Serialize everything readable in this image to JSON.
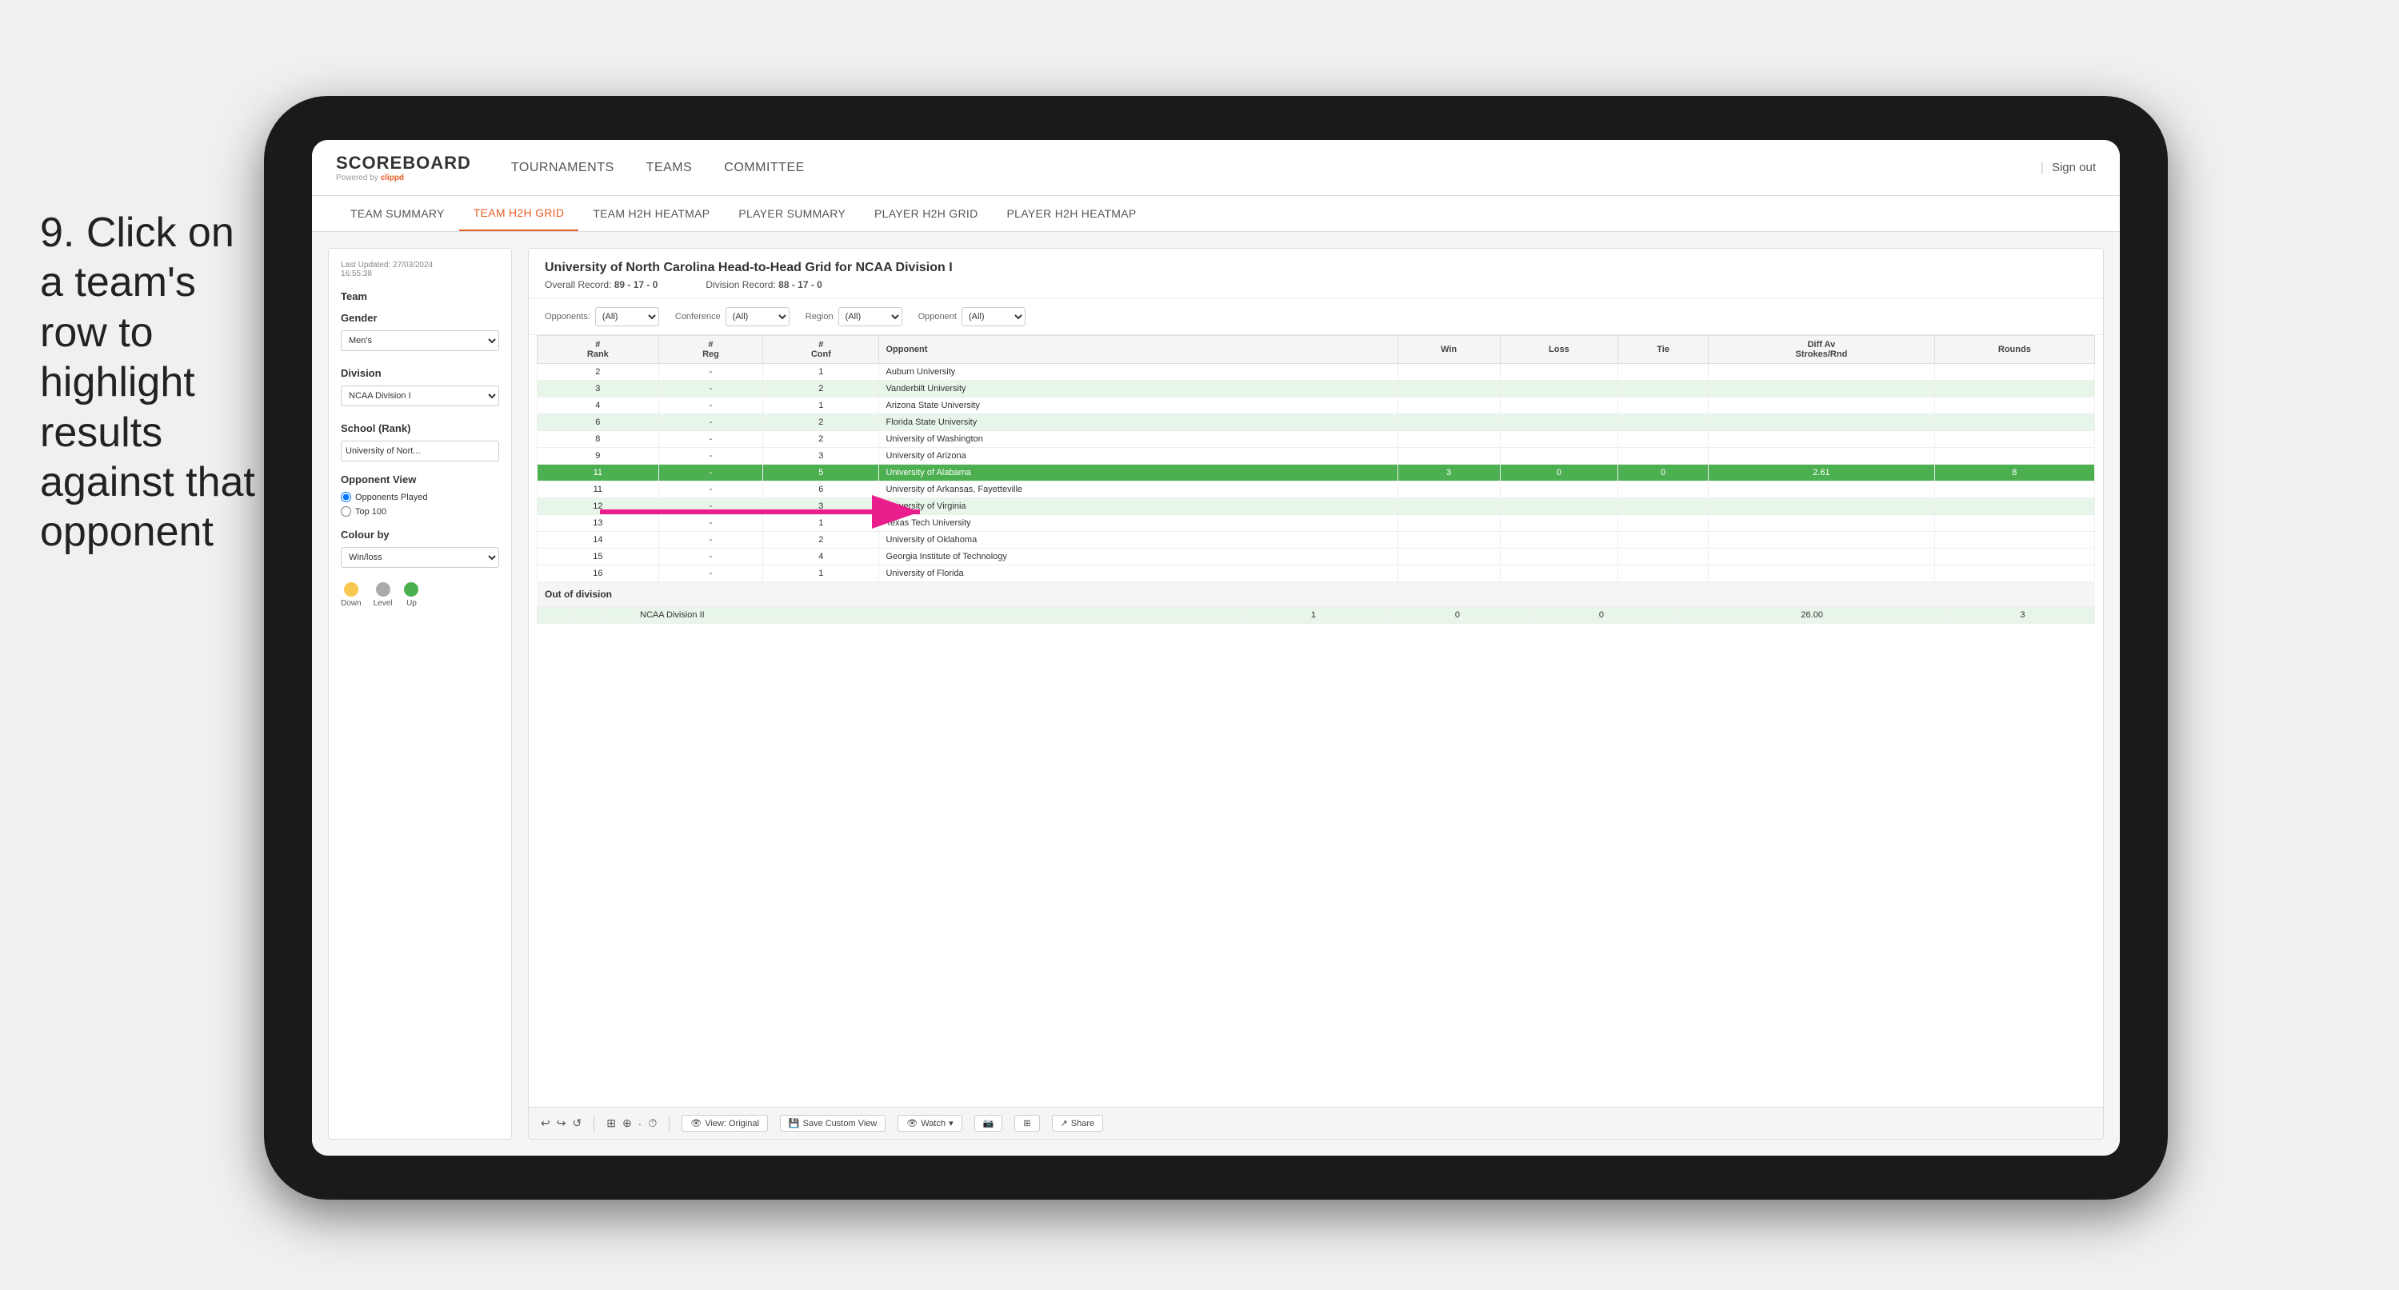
{
  "instruction": {
    "step": "9.",
    "text": "Click on a team's row to highlight results against that opponent"
  },
  "nav": {
    "logo": "SCOREBOARD",
    "powered_by": "Powered by",
    "brand": "clippd",
    "items": [
      "TOURNAMENTS",
      "TEAMS",
      "COMMITTEE"
    ],
    "sign_out": "Sign out"
  },
  "sub_nav": {
    "items": [
      "TEAM SUMMARY",
      "TEAM H2H GRID",
      "TEAM H2H HEATMAP",
      "PLAYER SUMMARY",
      "PLAYER H2H GRID",
      "PLAYER H2H HEATMAP"
    ],
    "active": "TEAM H2H GRID"
  },
  "sidebar": {
    "last_updated_label": "Last Updated: 27/03/2024",
    "last_updated_time": "16:55:38",
    "team_label": "Team",
    "gender_label": "Gender",
    "gender_value": "Men's",
    "division_label": "Division",
    "division_value": "NCAA Division I",
    "school_label": "School (Rank)",
    "school_value": "University of Nort...",
    "opponent_view_label": "Opponent View",
    "opponents_played": "Opponents Played",
    "top_100": "Top 100",
    "colour_by_label": "Colour by",
    "colour_by_value": "Win/loss",
    "legend": [
      {
        "label": "Down",
        "color": "#f9c74f"
      },
      {
        "label": "Level",
        "color": "#aaaaaa"
      },
      {
        "label": "Up",
        "color": "#4caf50"
      }
    ]
  },
  "panel": {
    "title": "University of North Carolina Head-to-Head Grid for NCAA Division I",
    "overall_record_label": "Overall Record:",
    "overall_record_value": "89 - 17 - 0",
    "division_record_label": "Division Record:",
    "division_record_value": "88 - 17 - 0",
    "filters": {
      "opponents_label": "Opponents:",
      "opponents_value": "(All)",
      "conference_label": "Conference",
      "conference_value": "(All)",
      "region_label": "Region",
      "region_value": "(All)",
      "opponent_label": "Opponent",
      "opponent_value": "(All)"
    },
    "table_headers": [
      "#\nRank",
      "#\nReg",
      "#\nConf",
      "Opponent",
      "Win",
      "Loss",
      "Tie",
      "Diff Av\nStrokes/Rnd",
      "Rounds"
    ],
    "rows": [
      {
        "rank": "2",
        "reg": "-",
        "conf": "1",
        "opponent": "Auburn University",
        "win": "",
        "loss": "",
        "tie": "",
        "diff": "",
        "rounds": "",
        "highlight": false,
        "row_color": ""
      },
      {
        "rank": "3",
        "reg": "-",
        "conf": "2",
        "opponent": "Vanderbilt University",
        "win": "",
        "loss": "",
        "tie": "",
        "diff": "",
        "rounds": "",
        "highlight": false,
        "row_color": "light-green"
      },
      {
        "rank": "4",
        "reg": "-",
        "conf": "1",
        "opponent": "Arizona State University",
        "win": "",
        "loss": "",
        "tie": "",
        "diff": "",
        "rounds": "",
        "highlight": false,
        "row_color": ""
      },
      {
        "rank": "6",
        "reg": "-",
        "conf": "2",
        "opponent": "Florida State University",
        "win": "",
        "loss": "",
        "tie": "",
        "diff": "",
        "rounds": "",
        "highlight": false,
        "row_color": "light-green"
      },
      {
        "rank": "8",
        "reg": "-",
        "conf": "2",
        "opponent": "University of Washington",
        "win": "",
        "loss": "",
        "tie": "",
        "diff": "",
        "rounds": "",
        "highlight": false,
        "row_color": ""
      },
      {
        "rank": "9",
        "reg": "-",
        "conf": "3",
        "opponent": "University of Arizona",
        "win": "",
        "loss": "",
        "tie": "",
        "diff": "",
        "rounds": "",
        "highlight": false,
        "row_color": ""
      },
      {
        "rank": "11",
        "reg": "-",
        "conf": "5",
        "opponent": "University of Alabama",
        "win": "3",
        "loss": "0",
        "tie": "0",
        "diff": "2.61",
        "rounds": "8",
        "highlight": true,
        "row_color": "green"
      },
      {
        "rank": "11",
        "reg": "-",
        "conf": "6",
        "opponent": "University of Arkansas, Fayetteville",
        "win": "",
        "loss": "",
        "tie": "",
        "diff": "",
        "rounds": "",
        "highlight": false,
        "row_color": ""
      },
      {
        "rank": "12",
        "reg": "-",
        "conf": "3",
        "opponent": "University of Virginia",
        "win": "",
        "loss": "",
        "tie": "",
        "diff": "",
        "rounds": "",
        "highlight": false,
        "row_color": "light-green"
      },
      {
        "rank": "13",
        "reg": "-",
        "conf": "1",
        "opponent": "Texas Tech University",
        "win": "",
        "loss": "",
        "tie": "",
        "diff": "",
        "rounds": "",
        "highlight": false,
        "row_color": ""
      },
      {
        "rank": "14",
        "reg": "-",
        "conf": "2",
        "opponent": "University of Oklahoma",
        "win": "",
        "loss": "",
        "tie": "",
        "diff": "",
        "rounds": "",
        "highlight": false,
        "row_color": ""
      },
      {
        "rank": "15",
        "reg": "-",
        "conf": "4",
        "opponent": "Georgia Institute of Technology",
        "win": "",
        "loss": "",
        "tie": "",
        "diff": "",
        "rounds": "",
        "highlight": false,
        "row_color": ""
      },
      {
        "rank": "16",
        "reg": "-",
        "conf": "1",
        "opponent": "University of Florida",
        "win": "",
        "loss": "",
        "tie": "",
        "diff": "",
        "rounds": "",
        "highlight": false,
        "row_color": ""
      }
    ],
    "out_of_division_label": "Out of division",
    "out_of_division_row": {
      "division": "NCAA Division II",
      "win": "1",
      "loss": "0",
      "tie": "0",
      "diff": "26.00",
      "rounds": "3"
    }
  },
  "toolbar": {
    "view_original": "View: Original",
    "save_custom": "Save Custom View",
    "watch": "Watch",
    "share": "Share"
  },
  "colors": {
    "highlight_green": "#4caf50",
    "light_green": "#e8f5e9",
    "medium_green": "#c8e6c9",
    "active_tab": "#e85d26",
    "accent": "#e85d26"
  }
}
